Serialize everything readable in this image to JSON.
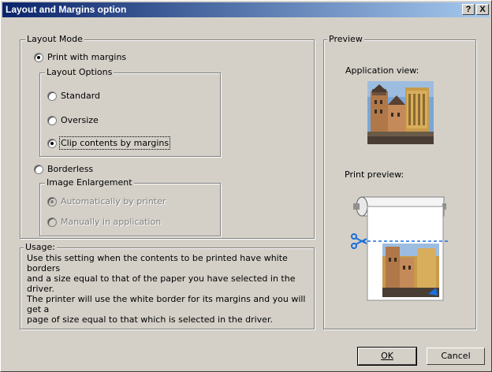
{
  "window": {
    "title": "Layout and Margins option"
  },
  "titlebar_buttons": {
    "help": "?",
    "close": "X"
  },
  "layout_mode": {
    "legend": "Layout Mode",
    "print_with_margins": "Print with margins",
    "borderless": "Borderless",
    "selected": "print_with_margins"
  },
  "layout_options": {
    "legend": "Layout Options",
    "standard": "Standard",
    "oversize": "Oversize",
    "clip": "Clip contents by margins",
    "selected": "clip"
  },
  "image_enlargement": {
    "legend": "Image Enlargement",
    "auto": "Automatically by printer",
    "manual": "Manually in application",
    "enabled": false,
    "selected": "auto"
  },
  "usage": {
    "legend": "Usage:",
    "lines": [
      "Use this setting when the contents to be printed have white borders",
      "and a size equal to that of the paper you have selected in the driver.",
      "The printer will use the white border for its margins and you will get a",
      "page of size equal to that which is selected in the driver."
    ]
  },
  "preview": {
    "legend": "Preview",
    "app_view_label": "Application view:",
    "print_preview_label": "Print preview:",
    "scissors_icon": "scissors-icon",
    "accent_color": "#1a6fdc"
  },
  "buttons": {
    "ok": "OK",
    "cancel": "Cancel"
  }
}
